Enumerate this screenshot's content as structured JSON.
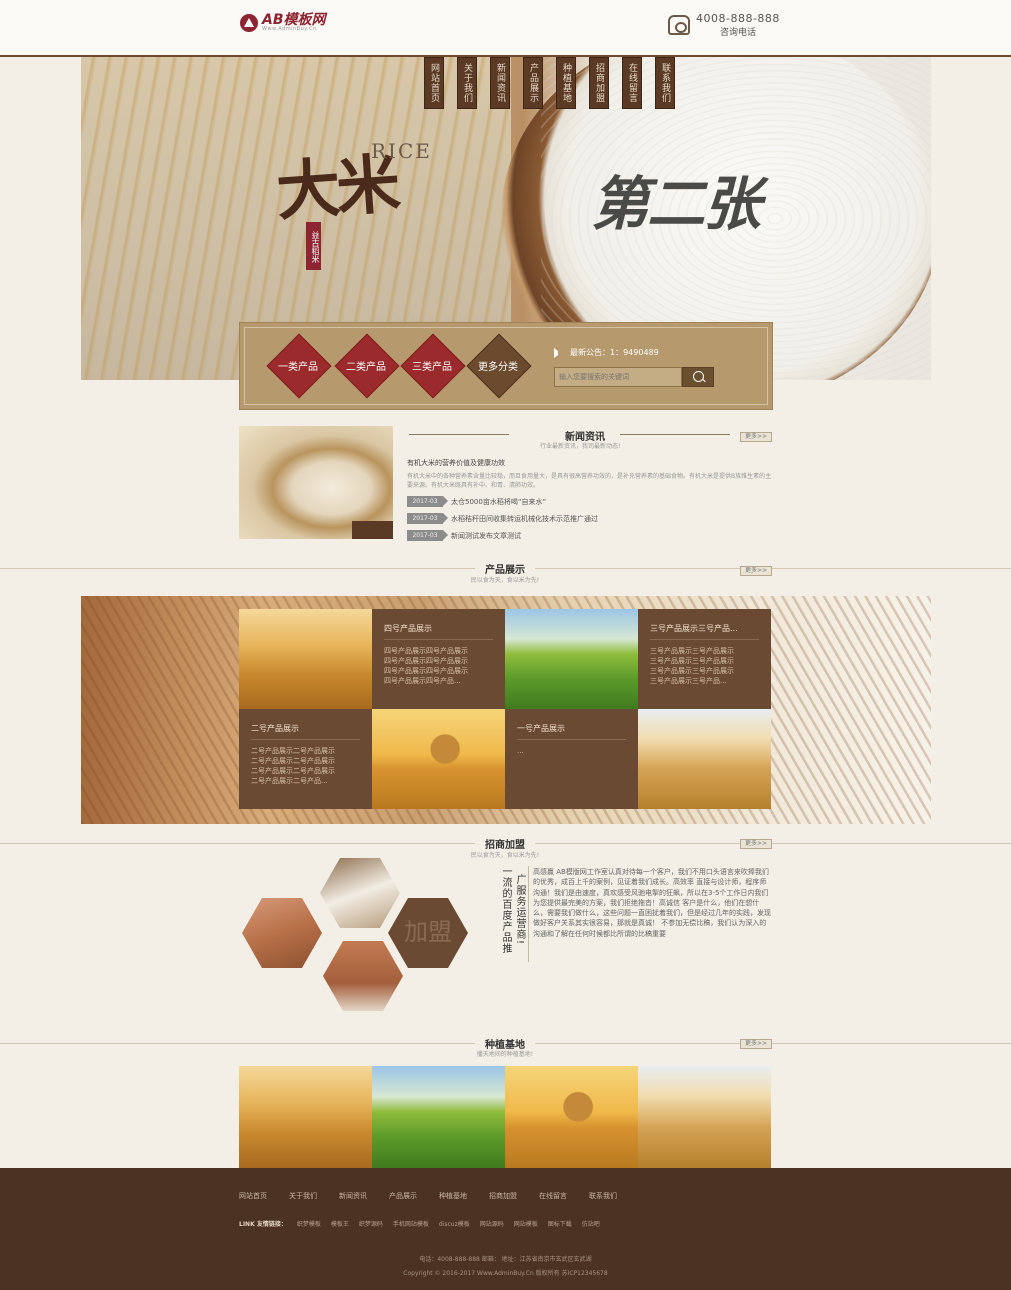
{
  "header": {
    "logo_text": "AB模板网",
    "logo_sub": "Www.AdminBuy.Cn",
    "phone": "4008-888-888",
    "phone_label": "咨询电话"
  },
  "nav": [
    {
      "label": "网站首页"
    },
    {
      "label": "关于我们"
    },
    {
      "label": "新闻资讯"
    },
    {
      "label": "产品展示"
    },
    {
      "label": "种植基地"
    },
    {
      "label": "招商加盟"
    },
    {
      "label": "在线留言"
    },
    {
      "label": "联系我们"
    }
  ],
  "banner": {
    "calligraphy": "大米",
    "rice": "RICE",
    "seal": "益古稻米",
    "title": "第二张"
  },
  "categories": {
    "items": [
      "一类产品",
      "二类产品",
      "三类产品"
    ],
    "more": "更多分类",
    "notice": "最新公告：1：9490489",
    "search_placeholder": "输入您要搜索的关键词"
  },
  "news": {
    "title": "新闻资讯",
    "subtitle": "行业最新资讯，我司最新动态!",
    "more": "更多>>",
    "headline": "有机大米的营养价值及健康功效",
    "desc": "有机大米中的各种营养素含量比较稳，而且食用量大，是具有很高营养功效的，是补充营养素的基础食物。有机大米是提供B族维生素的主要来源。有机大米既具有补中、和胃、清肺功效。",
    "rows": [
      {
        "date": "2017-03",
        "text": "太仓5000亩水稻将喝“自来水”"
      },
      {
        "date": "2017-03",
        "text": "水稻秸秆田间收集转运机械化技术示范推广通过"
      },
      {
        "date": "2017-03",
        "text": "新闻测试发布文章测试"
      }
    ]
  },
  "products": {
    "title": "产品展示",
    "subtitle": "民以食为天，食以米为先!",
    "more": "更多>>",
    "tiles": [
      {
        "title": "四号产品展示",
        "lines": [
          "四号产品展示四号产品展示",
          "四号产品展示四号产品展示",
          "四号产品展示四号产品展示",
          "四号产品展示四号产品...",
          ""
        ]
      },
      {
        "title": "三号产品展示三号产品...",
        "lines": [
          "三号产品展示三号产品展示",
          "三号产品展示三号产品展示",
          "三号产品展示三号产品展示",
          "三号产品展示三号产品...",
          ""
        ]
      },
      {
        "title": "二号产品展示",
        "lines": [
          "二号产品展示二号产品展示",
          "二号产品展示二号产品展示",
          "二号产品展示二号产品展示",
          "二号产品展示二号产品...",
          ""
        ]
      },
      {
        "title": "一号产品展示",
        "lines": [
          "...",
          "",
          "",
          "",
          ""
        ]
      }
    ]
  },
  "join": {
    "title": "招商加盟",
    "subtitle": "民以食为天，食以米为先!",
    "more": "更多>>",
    "vert1": "一流的百度产品推",
    "vert2": "广服务运营商!",
    "hex_text": "加盟",
    "text": "高感赢 AB模版网工作室认真对待每一个客户，我们不用口头语言来吹捧我们的优秀，成百上千的案例，见证着我们成长。高效率 直接与设计师，程序师沟通！我们是由速度，真欢感受风驰电掣的狂飙，所以在3-5个工作日内我们为您提供最完美的方案，我们拒绝拖沓！高诚信 客户是什么，他们在想什么，需要我们做什么，这些问题一直困扰着我们，但是经过几年的实践，发现做好客户关系其实很容易，那就是真诚！ 不参加无偿比稿，我们认为深入的沟通和了解在任何时候都比所谓的比稿重要"
  },
  "base": {
    "title": "种植基地",
    "subtitle": "播天地间的种植基地!",
    "more": "更多>>"
  },
  "footer": {
    "nav": [
      "网站首页",
      "关于我们",
      "新闻资讯",
      "产品展示",
      "种植基地",
      "招商加盟",
      "在线留言",
      "联系我们"
    ],
    "links_label": "LINK 友情链接：",
    "links": [
      "织梦模板",
      "模板王",
      "织梦源码",
      "手机网站模板",
      "discuz模板",
      "网站源码",
      "网站模板",
      "图标下载",
      "仿站吧"
    ],
    "contact": "电话：4008-888-888  邮箱：  地址：江苏省南京市玄武区玄武湖",
    "copyright": "Copyright © 2016-2017 Www.AdminBuy.Cn 版权所有  苏ICP12345678"
  }
}
